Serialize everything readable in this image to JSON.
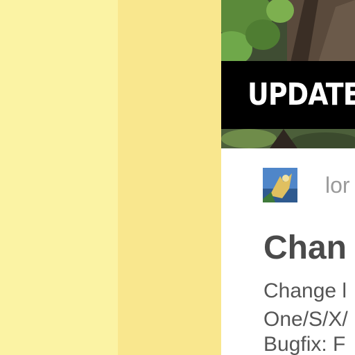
{
  "banner": {
    "text": "UPDATE"
  },
  "post": {
    "author": "lor",
    "title": "Chan",
    "lines": [
      "Change l",
      "One/S/X/",
      "Bugfix: F"
    ]
  },
  "colors": {
    "page_background": "#fbf3a4",
    "stripe": "#f9e78e",
    "banner_background": "#000000",
    "banner_text": "#ffffff",
    "title_text": "#4a4a4a",
    "body_text": "#555555",
    "author_text": "#9a9a9a"
  },
  "icons": {
    "avatar": "user-avatar"
  }
}
